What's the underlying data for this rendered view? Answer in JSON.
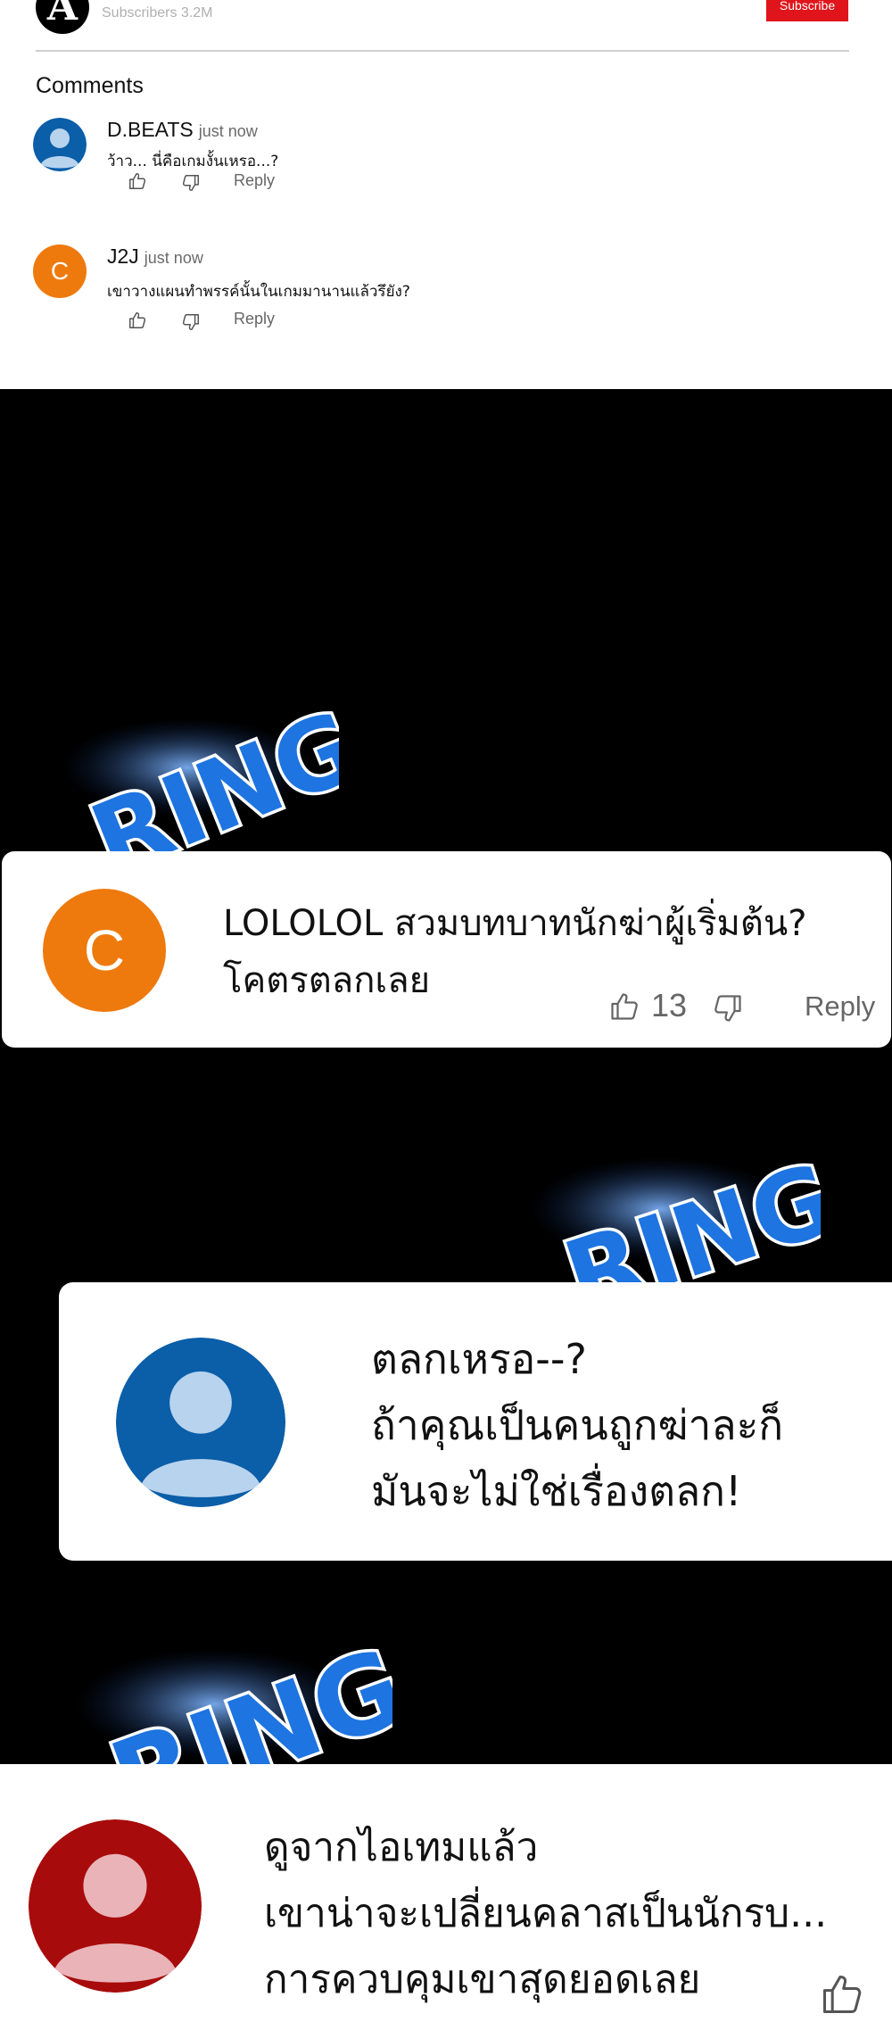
{
  "channel": {
    "logo_letter": "A",
    "subscribers": "Subscribers 3.2M",
    "subscribe_label": "Subscribe"
  },
  "comments_heading": "Comments",
  "small_comments": [
    {
      "author": "D.BEATS",
      "time": "just now",
      "text": "ว้าว... นี่คือเกมงั้นเหรอ...?",
      "reply_label": "Reply",
      "avatar": "user-silhouette",
      "avatar_color": "#0b5ea8"
    },
    {
      "author": "J2J",
      "time": "just now",
      "text": "เขาวางแผนทำพรรค์นั้นในเกมมานานแล้วรึยัง?",
      "reply_label": "Reply",
      "avatar_letter": "C",
      "avatar_color": "#ee7a0e"
    }
  ],
  "sfx_text": "RING",
  "big_comments": [
    {
      "avatar_letter": "C",
      "avatar_color": "#ee7a0e",
      "line1": "LOLOLOL สวมบทบาทนักฆ่าผู้เริ่มต้น?",
      "line2": "โคตรตลกเลย",
      "like_count": "13",
      "reply_label": "Reply"
    },
    {
      "avatar": "user-silhouette",
      "avatar_color": "#0b5ea8",
      "line1": "ตลกเหรอ--?",
      "line2": "ถ้าคุณเป็นคนถูกฆ่าละก็",
      "line3": "มันจะไม่ใช่เรื่องตลก!"
    },
    {
      "avatar": "user-silhouette",
      "avatar_color": "#a80b0b",
      "line1": "ดูจากไอเทมแล้ว",
      "line2": "เขาน่าจะเปลี่ยนคลาสเป็นนักรบ...",
      "line3": "การควบคุมเขาสุดยอดเลย"
    }
  ],
  "icons": [
    "thumbs-up-icon",
    "thumbs-down-icon",
    "user-silhouette-icon"
  ]
}
